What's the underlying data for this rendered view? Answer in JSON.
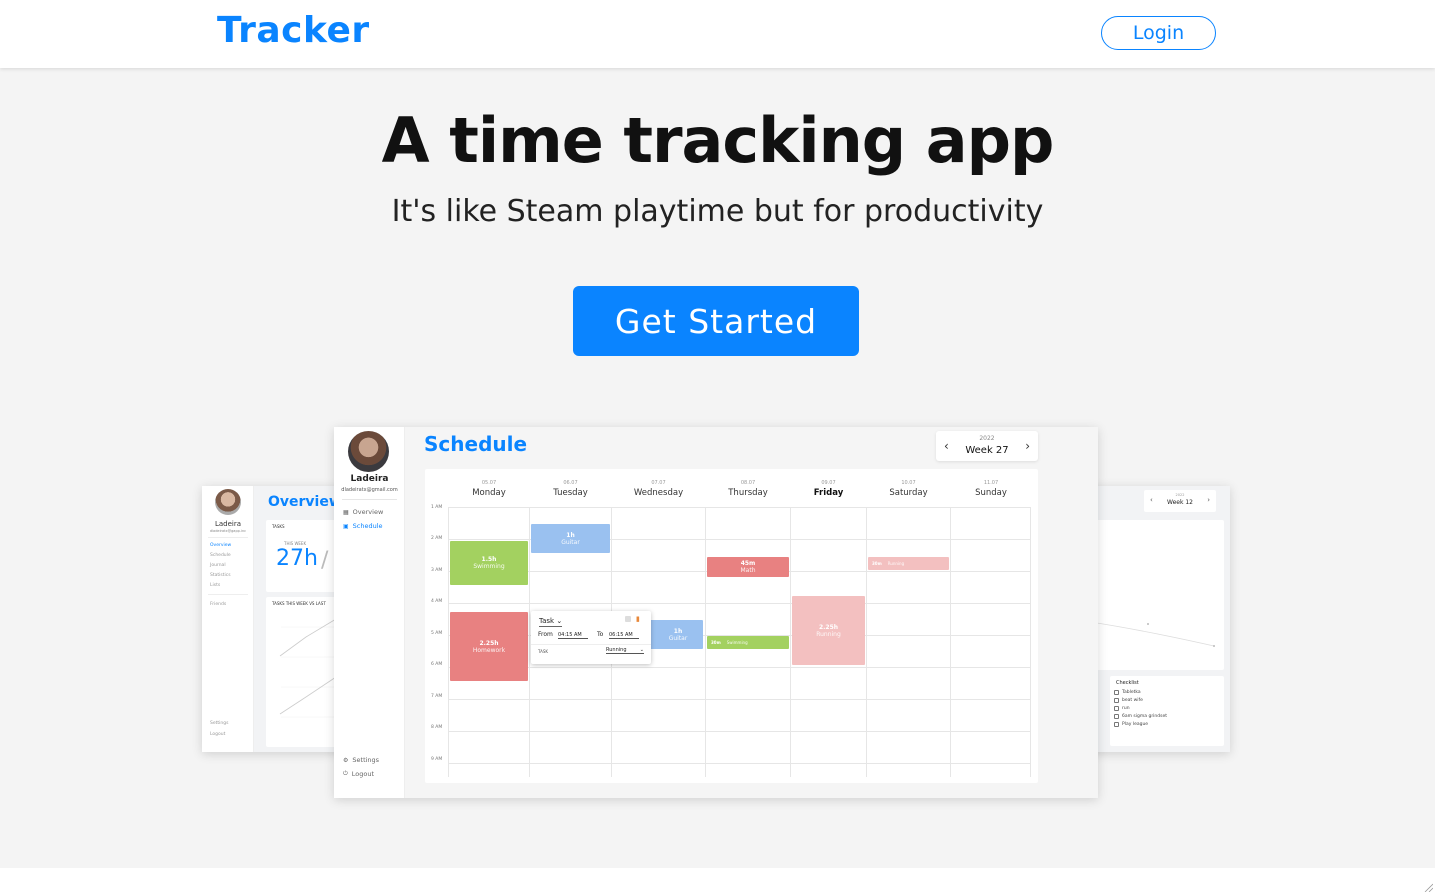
{
  "brand": "Tracker",
  "login_label": "Login",
  "hero": {
    "headline": "A time tracking app",
    "subline": "It's like Steam playtime but for productivity",
    "cta_label": "Get Started"
  },
  "preview": {
    "user": {
      "name": "Ladeira",
      "email": "dladeiratx@gmail.com"
    },
    "nav": [
      "Overview",
      "Schedule"
    ],
    "nav_bottom": [
      "Settings",
      "Logout"
    ],
    "page_title": "Schedule",
    "year": "2022",
    "week": "Week 27",
    "days": [
      {
        "date": "05.07",
        "name": "Monday"
      },
      {
        "date": "06.07",
        "name": "Tuesday"
      },
      {
        "date": "07.07",
        "name": "Wednesday"
      },
      {
        "date": "08.07",
        "name": "Thursday"
      },
      {
        "date": "09.07",
        "name": "Friday"
      },
      {
        "date": "10.07",
        "name": "Saturday"
      },
      {
        "date": "11.07",
        "name": "Sunday"
      }
    ],
    "hours": [
      "1 AM",
      "2 AM",
      "3 AM",
      "4 AM",
      "5 AM",
      "6 AM",
      "7 AM",
      "8 AM",
      "9 AM"
    ],
    "events": [
      {
        "duration": "1h",
        "name": "Guitar"
      },
      {
        "duration": "1.5h",
        "name": "Swimming"
      },
      {
        "duration": "45m",
        "name": "Math"
      },
      {
        "duration": "30m",
        "name": "Running"
      },
      {
        "duration": "2.25h",
        "name": "Homework"
      },
      {
        "duration": "1h",
        "name": "Guitar"
      },
      {
        "duration": "30m",
        "name": "Swimming"
      },
      {
        "duration": "2.25h",
        "name": "Running"
      }
    ],
    "popup": {
      "task_label": "Task",
      "from_label": "From",
      "from_value": "04:15 AM",
      "to_label": "To",
      "to_value": "06:15 AM",
      "field_label": "TASK",
      "field_value": "Running"
    }
  },
  "left_preview": {
    "user": {
      "name": "Ladeira",
      "email": "dladeiratx@gapp.inc"
    },
    "nav": [
      "Overview",
      "Schedule",
      "Journal",
      "Statistics",
      "Lists",
      "Friends"
    ],
    "nav_bottom": [
      "Settings",
      "Logout"
    ],
    "page_title": "Overview",
    "card_label": "TASKS",
    "this_week_label": "THIS WEEK",
    "hours_value": "27h",
    "chart_label": "TASKS THIS WEEK VS LAST"
  },
  "right_preview": {
    "week": "Week 12",
    "year": "2022",
    "checklist_title": "Checklist",
    "checklist": [
      "Tabletka",
      "beat wife",
      "run",
      "6am sigma grindset",
      "Play league"
    ]
  },
  "colors": {
    "accent": "#0a84ff",
    "green": "#a3d160",
    "red": "#e88181",
    "blue": "#9ac1f0",
    "pink": "#f3c0c0"
  }
}
